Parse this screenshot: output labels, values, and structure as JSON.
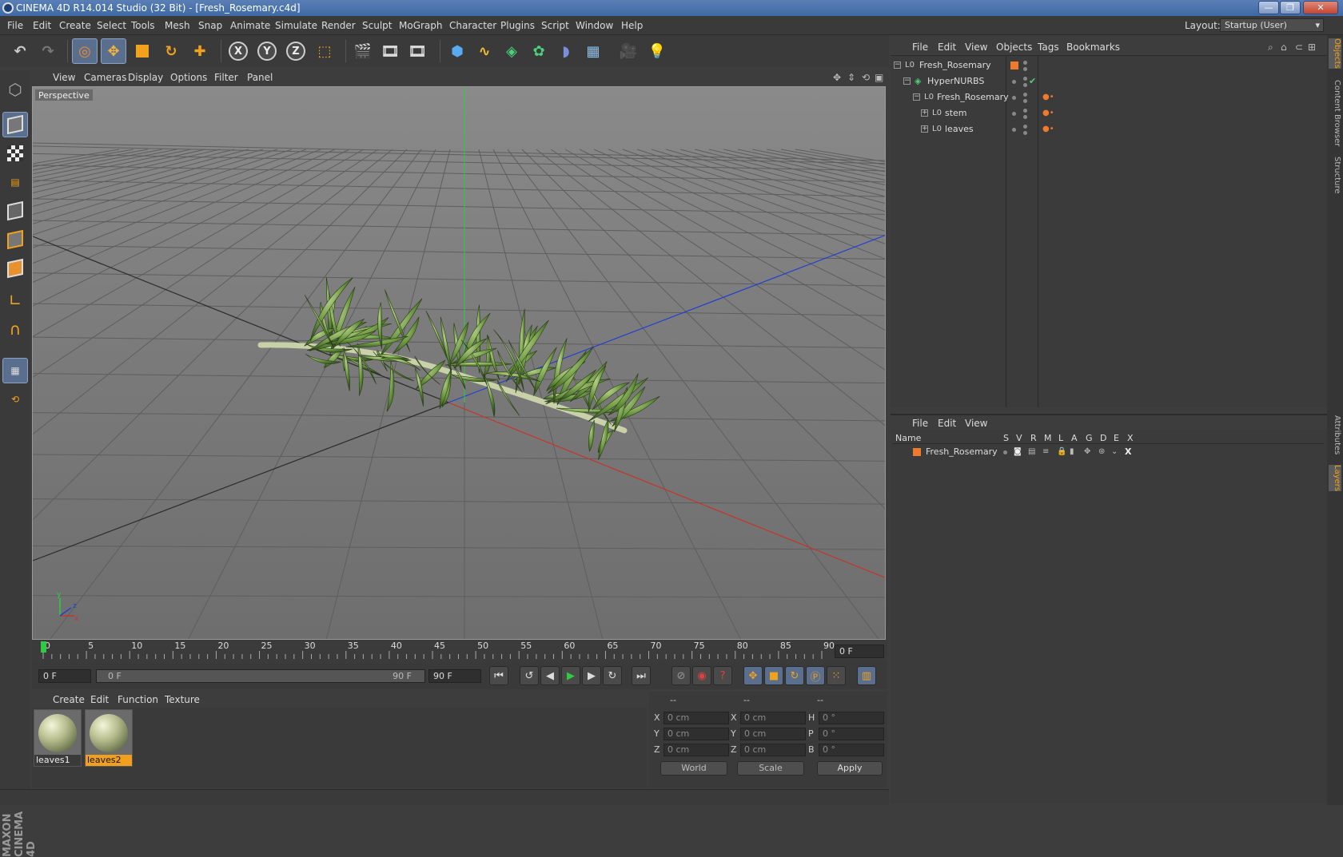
{
  "window": {
    "title": "CINEMA 4D R14.014 Studio (32 Bit) - [Fresh_Rosemary.c4d]",
    "minimize": "—",
    "restore": "❐",
    "close": "✕"
  },
  "menubar": {
    "items": [
      "File",
      "Edit",
      "Create",
      "Select",
      "Tools",
      "Mesh",
      "Snap",
      "Animate",
      "Simulate",
      "Render",
      "Sculpt",
      "MoGraph",
      "Character",
      "Plugins",
      "Script",
      "Window",
      "Help"
    ],
    "layout_label": "Layout:",
    "layout_value": "Startup (User)"
  },
  "toolbar": {
    "axis_x": "X",
    "axis_y": "Y",
    "axis_z": "Z"
  },
  "viewport": {
    "menu": [
      "View",
      "Cameras",
      "Display",
      "Options",
      "Filter",
      "Panel"
    ],
    "label": "Perspective",
    "axis_y": "y",
    "axis_z": "z",
    "axis_x": "x"
  },
  "timeline": {
    "ticks": [
      "0",
      "5",
      "10",
      "15",
      "20",
      "25",
      "30",
      "35",
      "40",
      "45",
      "50",
      "55",
      "60",
      "65",
      "70",
      "75",
      "80",
      "85",
      "90"
    ],
    "current_frame": "0 F"
  },
  "transport": {
    "start_field": "0 F",
    "range_start": "0 F",
    "range_end": "90 F",
    "end_field": "90 F"
  },
  "materials": {
    "menu": [
      "Create",
      "Edit",
      "Function",
      "Texture"
    ],
    "items": [
      {
        "name": "leaves1",
        "selected": false
      },
      {
        "name": "leaves2",
        "selected": true
      }
    ]
  },
  "coords": {
    "headers": [
      "--",
      "--",
      "--"
    ],
    "rows": [
      {
        "l1": "X",
        "v1": "0 cm",
        "l2": "X",
        "v2": "0 cm",
        "l3": "H",
        "v3": "0 °"
      },
      {
        "l1": "Y",
        "v1": "0 cm",
        "l2": "Y",
        "v2": "0 cm",
        "l3": "P",
        "v3": "0 °"
      },
      {
        "l1": "Z",
        "v1": "0 cm",
        "l2": "Z",
        "v2": "0 cm",
        "l3": "B",
        "v3": "0 °"
      }
    ],
    "mode1": "World",
    "mode2": "Scale",
    "apply": "Apply"
  },
  "objects": {
    "menu": [
      "File",
      "Edit",
      "View",
      "Objects",
      "Tags",
      "Bookmarks"
    ],
    "tree": [
      {
        "name": "Fresh_Rosemary",
        "indent": 0
      },
      {
        "name": "HyperNURBS",
        "indent": 1
      },
      {
        "name": "Fresh_Rosemary",
        "indent": 2
      },
      {
        "name": "stem",
        "indent": 3
      },
      {
        "name": "leaves",
        "indent": 3
      }
    ]
  },
  "layers": {
    "menu": [
      "File",
      "Edit",
      "View"
    ],
    "headers": [
      "Name",
      "S",
      "V",
      "R",
      "M",
      "L",
      "A",
      "G",
      "D",
      "E",
      "X"
    ],
    "rows": [
      {
        "name": "Fresh_Rosemary"
      }
    ]
  },
  "side_tabs": [
    "Objects",
    "Content Browser",
    "Structure",
    "Attributes",
    "Layers"
  ],
  "brand": "MAXON CINEMA 4D",
  "colors": {
    "accent_orange": "#f0a01c",
    "selection_blue": "#5a6e8e",
    "x_axis": "#c0392b",
    "y_axis": "#2ecc40",
    "z_axis": "#2040d0"
  }
}
